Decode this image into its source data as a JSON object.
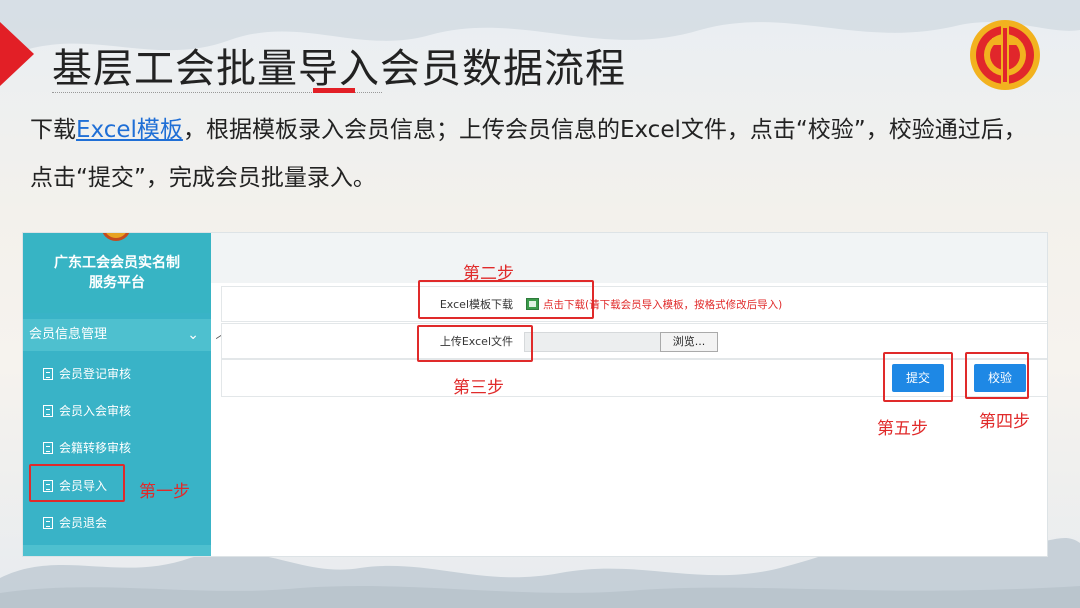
{
  "slide": {
    "title": "基层工会批量导入会员数据流程",
    "intro_part1": "下载",
    "intro_link": "Excel模板",
    "intro_part2": "，根据模板录入会员信息；上传会员信息的Excel文件，点击“校验”，校验通过后，点击“提交”，完成会员批量录入。"
  },
  "colors": {
    "accent_red": "#e21f26",
    "sidebar_teal": "#39b3c7",
    "button_blue": "#1e88e5",
    "link_blue": "#1f6fd6"
  },
  "app": {
    "brand": "广东工会会员实名制服务平台",
    "menu_group": "会员信息管理",
    "menu_items": [
      "会员登记审核",
      "会员入会审核",
      "会籍转移审核",
      "会员导入",
      "会员退会"
    ],
    "form": {
      "template_label": "Excel模板下载",
      "template_link": "点击下载(请下载会员导入模板，按格式修改后导入)",
      "upload_label": "上传Excel文件",
      "browse_label": "浏览...",
      "submit_label": "提交",
      "verify_label": "校验"
    }
  },
  "steps": {
    "step1": "第一步",
    "step2": "第二步",
    "step3": "第三步",
    "step4": "第四步",
    "step5": "第五步"
  },
  "icons": [
    "union-logo-icon",
    "chevron-down-icon",
    "chevron-up-icon",
    "document-icon",
    "excel-file-icon"
  ]
}
